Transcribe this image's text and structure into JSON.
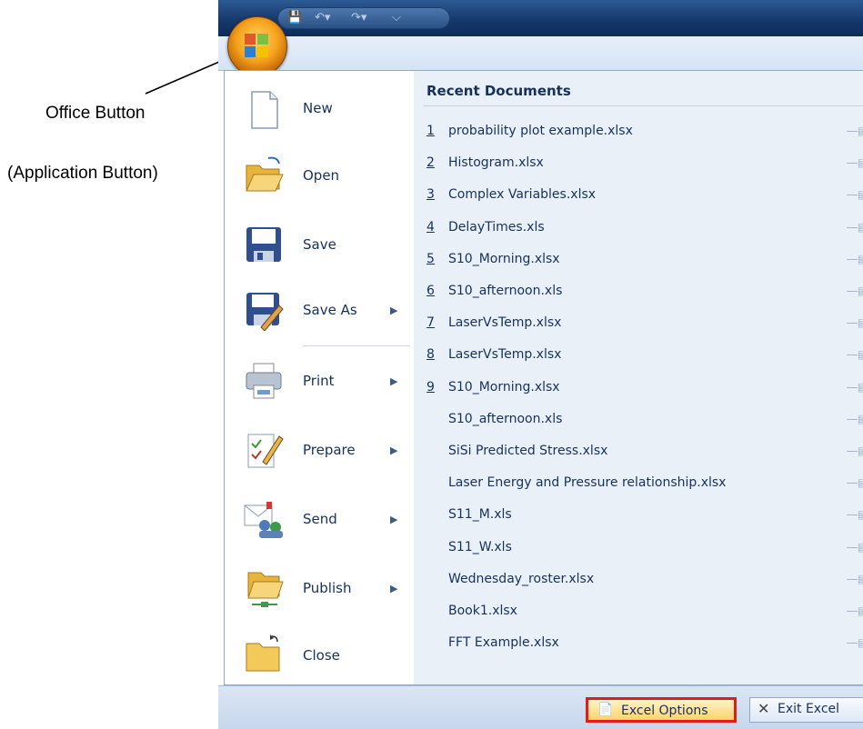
{
  "annotations": {
    "office_button": "Office Button",
    "application_button": "(Application Button)"
  },
  "quick_access": {
    "save_icon": "save-icon",
    "undo_icon": "undo-icon",
    "redo_icon": "redo-icon",
    "customize_icon": "customize-icon"
  },
  "commands": [
    {
      "label": "New",
      "icon": "new-document-icon",
      "submenu": false
    },
    {
      "label": "Open",
      "icon": "open-folder-icon",
      "submenu": false
    },
    {
      "label": "Save",
      "icon": "save-disk-icon",
      "submenu": false
    },
    {
      "label": "Save As",
      "icon": "save-as-icon",
      "submenu": true
    },
    {
      "label": "Print",
      "icon": "printer-icon",
      "submenu": true
    },
    {
      "label": "Prepare",
      "icon": "prepare-icon",
      "submenu": true
    },
    {
      "label": "Send",
      "icon": "send-icon",
      "submenu": true
    },
    {
      "label": "Publish",
      "icon": "publish-icon",
      "submenu": true
    },
    {
      "label": "Close",
      "icon": "close-folder-icon",
      "submenu": false
    }
  ],
  "recent": {
    "title": "Recent Documents",
    "items": [
      {
        "num": "1",
        "name": "probability plot example.xlsx"
      },
      {
        "num": "2",
        "name": "Histogram.xlsx"
      },
      {
        "num": "3",
        "name": "Complex Variables.xlsx"
      },
      {
        "num": "4",
        "name": "DelayTimes.xls"
      },
      {
        "num": "5",
        "name": "S10_Morning.xlsx"
      },
      {
        "num": "6",
        "name": "S10_afternoon.xls"
      },
      {
        "num": "7",
        "name": "LaserVsTemp.xlsx"
      },
      {
        "num": "8",
        "name": "LaserVsTemp.xlsx"
      },
      {
        "num": "9",
        "name": "S10_Morning.xlsx"
      },
      {
        "num": "",
        "name": "S10_afternoon.xls"
      },
      {
        "num": "",
        "name": "SiSi Predicted Stress.xlsx"
      },
      {
        "num": "",
        "name": "Laser Energy and Pressure relationship.xlsx"
      },
      {
        "num": "",
        "name": "S11_M.xls"
      },
      {
        "num": "",
        "name": "S11_W.xls"
      },
      {
        "num": "",
        "name": "Wednesday_roster.xlsx"
      },
      {
        "num": "",
        "name": "Book1.xlsx"
      },
      {
        "num": "",
        "name": "FFT Example.xlsx"
      }
    ]
  },
  "footer": {
    "options_label": "Excel Options",
    "exit_label": "Exit Excel"
  },
  "colors": {
    "highlight": "#e21b1b",
    "text": "#15315c"
  }
}
